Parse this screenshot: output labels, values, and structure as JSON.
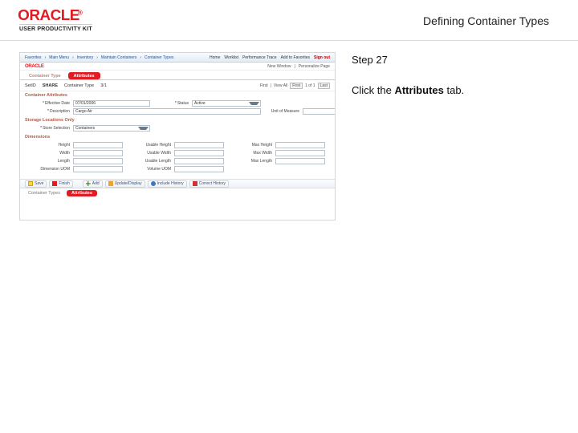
{
  "header": {
    "brand": "ORACLE",
    "reg": "®",
    "kit_line": "USER PRODUCTIVITY KIT",
    "page_title": "Defining Container Types"
  },
  "instruction": {
    "step_label": "Step 27",
    "text_prefix": "Click the ",
    "text_bold": "Attributes",
    "text_suffix": " tab."
  },
  "shot": {
    "breadcrumb": [
      "Favorites",
      "Main Menu",
      "Inventory",
      "Maintain Containers",
      "Container Types"
    ],
    "toolbar_links": [
      "Home",
      "Worklist",
      "Performance Trace",
      "Add to Favorites",
      "Sign out"
    ],
    "brand": "ORACLE",
    "new_window": "New Window",
    "personalize": "Personalize Page",
    "tab_active": "Attributes",
    "tab_other": "Container Type",
    "code_label": "SetID",
    "code_value": "SHARE",
    "type_label": "Container Type",
    "type_value": "3/1",
    "pager_find": "Find",
    "pager_viewall": "View All",
    "pager_first": "First",
    "pager_range": "1 of 1",
    "pager_last": "Last",
    "sec_attr": "Container Attributes",
    "f_eff_lbl": "Effective Date",
    "f_eff_val": "07/01/2006",
    "f_status_lbl": "Status",
    "f_status_val": "Active",
    "f_desc_lbl": "Description",
    "f_desc_val": "Cargo Air",
    "f_uom_lbl": "Unit of Measure",
    "f_uom_val": "",
    "sec_sto": "Storage Locations Only",
    "f_store_lbl": "Store Selection",
    "f_store_val": "Containers",
    "sec_dim": "Dimensions",
    "d_h": "Height",
    "d_w": "Width",
    "d_l": "Length",
    "d_uh": "Usable Height",
    "d_uw": "Usable Width",
    "d_ul": "Usable Length",
    "d_mh": "Max Height",
    "d_mw": "Max Width",
    "d_ml": "Max Length",
    "d_duom": "Dimension UOM",
    "d_vuom": "Volume UOM",
    "btn_save": "Save",
    "btn_finish": "Finish",
    "btn_add": "Add",
    "btn_update": "Update/Display",
    "btn_include": "Include History",
    "btn_correct": "Correct History",
    "btab_ct": "Container Types",
    "btab_attr": "Attributes"
  }
}
